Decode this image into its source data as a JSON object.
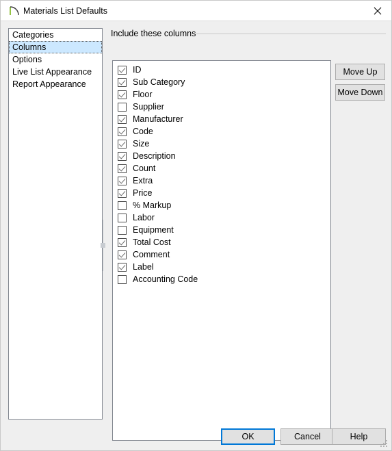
{
  "window": {
    "title": "Materials List Defaults",
    "icon": "chief-architect-arc-icon",
    "close_icon": "close-icon",
    "accent_color": "#0078d7",
    "selection_color": "#cce8ff",
    "logo_green": "#7ab317"
  },
  "sidebar": {
    "items": [
      {
        "label": "Categories",
        "selected": false
      },
      {
        "label": "Columns",
        "selected": true
      },
      {
        "label": "Options",
        "selected": false
      },
      {
        "label": "Live List Appearance",
        "selected": false
      },
      {
        "label": "Report Appearance",
        "selected": false
      }
    ]
  },
  "splitter": {
    "name": "vertical-splitter",
    "grip": "splitter-grip"
  },
  "groupbox": {
    "label": "Include these columns"
  },
  "columns": {
    "items": [
      {
        "label": "ID",
        "checked": true
      },
      {
        "label": "Sub Category",
        "checked": true
      },
      {
        "label": "Floor",
        "checked": true
      },
      {
        "label": "Supplier",
        "checked": false
      },
      {
        "label": "Manufacturer",
        "checked": true
      },
      {
        "label": "Code",
        "checked": true
      },
      {
        "label": "Size",
        "checked": true
      },
      {
        "label": "Description",
        "checked": true
      },
      {
        "label": "Count",
        "checked": true
      },
      {
        "label": "Extra",
        "checked": true
      },
      {
        "label": "Price",
        "checked": true
      },
      {
        "label": "% Markup",
        "checked": false
      },
      {
        "label": "Labor",
        "checked": false
      },
      {
        "label": "Equipment",
        "checked": false
      },
      {
        "label": "Total Cost",
        "checked": true
      },
      {
        "label": "Comment",
        "checked": true
      },
      {
        "label": "Label",
        "checked": true
      },
      {
        "label": "Accounting Code",
        "checked": false
      }
    ]
  },
  "side_buttons": {
    "move_up": "Move Up",
    "move_down": "Move Down"
  },
  "footer": {
    "ok": "OK",
    "cancel": "Cancel",
    "help": "Help"
  }
}
